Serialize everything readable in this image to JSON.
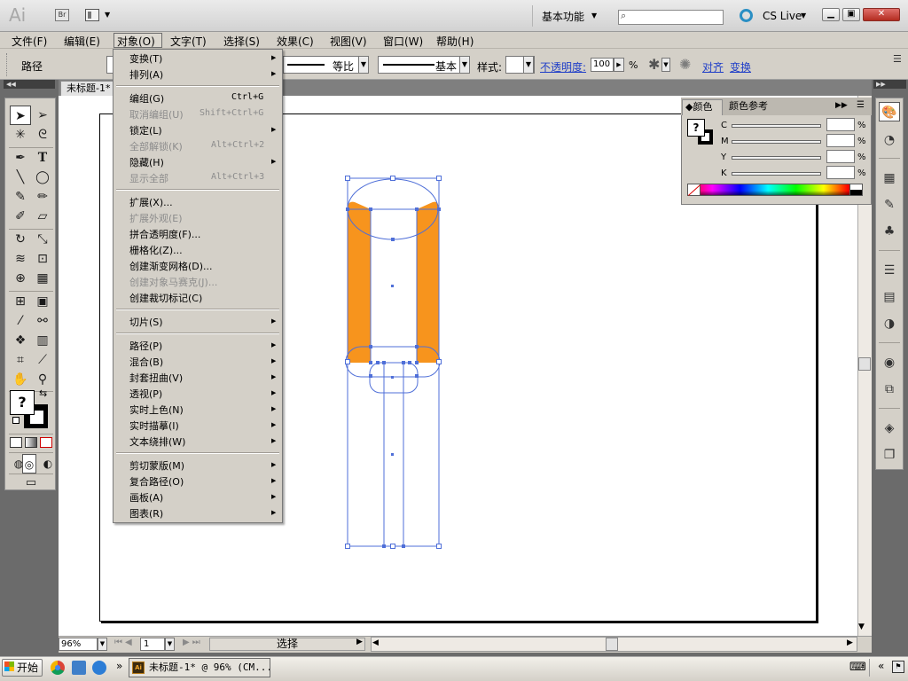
{
  "titlebar": {
    "logo": "Ai",
    "bridge_label": "Br",
    "workspace": "基本功能",
    "cs_live": "CS Live"
  },
  "menubar": {
    "items": [
      "文件(F)",
      "编辑(E)",
      "对象(O)",
      "文字(T)",
      "选择(S)",
      "效果(C)",
      "视图(V)",
      "窗口(W)",
      "帮助(H)"
    ],
    "active": "对象(O)"
  },
  "controlbar": {
    "selection_label": "路径",
    "variable_width_profile": "等比",
    "brush_definition": "基本",
    "style_label": "样式:",
    "opacity_label": "不透明度:",
    "opacity_value": "100",
    "opacity_unit": "%",
    "align_link": "对齐",
    "transform_link": "变换"
  },
  "document": {
    "tab_title": "未标题-1*"
  },
  "object_menu": {
    "items": [
      {
        "label": "变换(T)",
        "submenu": true
      },
      {
        "label": "排列(A)",
        "submenu": true
      },
      {
        "label": "编组(G)",
        "shortcut": "Ctrl+G"
      },
      {
        "label": "取消编组(U)",
        "shortcut": "Shift+Ctrl+G",
        "disabled": true
      },
      {
        "label": "锁定(L)",
        "submenu": true
      },
      {
        "label": "全部解锁(K)",
        "shortcut": "Alt+Ctrl+2",
        "disabled": true
      },
      {
        "label": "隐藏(H)",
        "submenu": true
      },
      {
        "label": "显示全部",
        "shortcut": "Alt+Ctrl+3",
        "disabled": true
      },
      {
        "label": "扩展(X)..."
      },
      {
        "label": "扩展外观(E)",
        "disabled": true
      },
      {
        "label": "拼合透明度(F)..."
      },
      {
        "label": "栅格化(Z)..."
      },
      {
        "label": "创建渐变网格(D)..."
      },
      {
        "label": "创建对象马赛克(J)...",
        "disabled": true
      },
      {
        "label": "创建裁切标记(C)"
      },
      {
        "label": "切片(S)",
        "submenu": true
      },
      {
        "label": "路径(P)",
        "submenu": true
      },
      {
        "label": "混合(B)",
        "submenu": true
      },
      {
        "label": "封套扭曲(V)",
        "submenu": true
      },
      {
        "label": "透视(P)",
        "submenu": true
      },
      {
        "label": "实时上色(N)",
        "submenu": true
      },
      {
        "label": "实时描摹(I)",
        "submenu": true
      },
      {
        "label": "文本绕排(W)",
        "submenu": true
      },
      {
        "label": "剪切蒙版(M)",
        "submenu": true
      },
      {
        "label": "复合路径(O)",
        "submenu": true
      },
      {
        "label": "画板(A)",
        "submenu": true
      },
      {
        "label": "图表(R)",
        "submenu": true
      }
    ]
  },
  "color_panel": {
    "tab_color": "颜色",
    "tab_guide": "颜色参考",
    "fill_label": "?",
    "channels": [
      "C",
      "M",
      "Y",
      "K"
    ],
    "percent": "%"
  },
  "tools": {
    "fill_label": "?"
  },
  "statusbar": {
    "zoom": "96%",
    "page": "1",
    "status": "选择"
  },
  "taskbar": {
    "start": "开始",
    "task_title": "未标题-1* @ 96% (CM...",
    "task_icon_label": "Ai"
  },
  "colors": {
    "artwork_fill": "#f7941d",
    "selection": "#4f6fd8"
  },
  "icons": [
    "search-icon",
    "selection-tool-icon",
    "pen-tool-icon",
    "type-tool-icon",
    "hand-tool-icon",
    "zoom-tool-icon",
    "color-panel-icon",
    "swatches-icon",
    "brushes-icon",
    "symbols-icon",
    "stroke-icon",
    "gradient-icon",
    "transparency-icon",
    "appearance-icon",
    "graphic-styles-icon",
    "layers-icon",
    "artboards-icon"
  ]
}
